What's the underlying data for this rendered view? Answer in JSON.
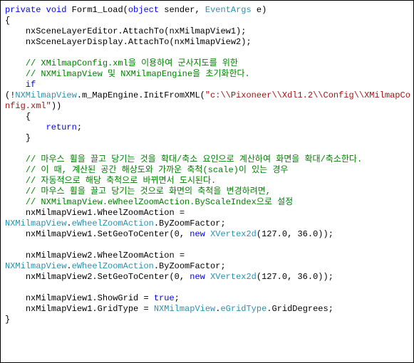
{
  "code": {
    "l01": {
      "kw1": "private",
      "kw2": "void",
      "name": "Form1_Load",
      "p": "(",
      "kw3": "object",
      "arg1": " sender, ",
      "type1": "EventArgs",
      "arg2": " e)"
    },
    "l02": "{",
    "l03": "    nxSceneLayerEditor.AttachTo(nxMilmapView1);",
    "l04": "    nxSceneLayerDisplay.AttachTo(nxMilmapView2);",
    "l05": "",
    "l06": "    // XMilmapConfig.xml을 이용하여 군사지도를 위한",
    "l07": "    // NXMilmapView 및 NXMilmapEngine을 초기화한다.",
    "l08_pre": "    ",
    "l08_kw": "if",
    "l09_open": "(!",
    "l09_type": "NXMilmapView",
    "l09_mid": ".m_MapEngine.InitFromXML(",
    "l09_str": "\"c:\\\\Pixoneer\\\\Xdl1.2\\\\Config\\\\XMilmapConfig.xml\"",
    "l09_end": "))",
    "l10": "    {",
    "l11_pre": "        ",
    "l11_kw": "return",
    "l11_post": ";",
    "l12": "    }",
    "l13": "",
    "l14": "    // 마우스 휠을 끌고 당기는 것을 확대/축소 요인으로 계산하여 화면을 확대/축소한다.",
    "l15": "    // 이 때, 계산된 공간 해상도와 가까운 축척(scale)이 있는 경우",
    "l16": "    // 자동적으로 해당 축척으로 바뀌면서 도시된다.",
    "l17": "    // 마우스 휠을 끌고 당기는 것으로 화면의 축척을 변경하려면,",
    "l18": "    // NXMilmapView.eWheelZoomAction.ByScaleIndex으로 설정",
    "l19": "    nxMilmapView1.WheelZoomAction = ",
    "l20_type": "NXMilmapView",
    "l20_mid": ".",
    "l20_type2": "eWheelZoomAction",
    "l20_rest": ".ByZoomFactor;",
    "l21_pre": "    nxMilmapView1.SetGeoToCenter(0, ",
    "l21_kw": "new",
    "l21_mid": " ",
    "l21_type": "XVertex2d",
    "l21_rest": "(127.0, 36.0));",
    "l22": "",
    "l23": "    nxMilmapView2.WheelZoomAction = ",
    "l24_type": "NXMilmapView",
    "l24_mid": ".",
    "l24_type2": "eWheelZoomAction",
    "l24_rest": ".ByZoomFactor;",
    "l25_pre": "    nxMilmapView2.SetGeoToCenter(0, ",
    "l25_kw": "new",
    "l25_mid": " ",
    "l25_type": "XVertex2d",
    "l25_rest": "(127.0, 36.0));",
    "l26": "",
    "l27_pre": "    nxMilmapView1.ShowGrid = ",
    "l27_kw": "true",
    "l27_post": ";",
    "l28_pre": "    nxMilmapView1.GridType = ",
    "l28_type": "NXMilmapView",
    "l28_mid": ".",
    "l28_type2": "eGridType",
    "l28_rest": ".GridDegrees;",
    "l29": "}"
  }
}
